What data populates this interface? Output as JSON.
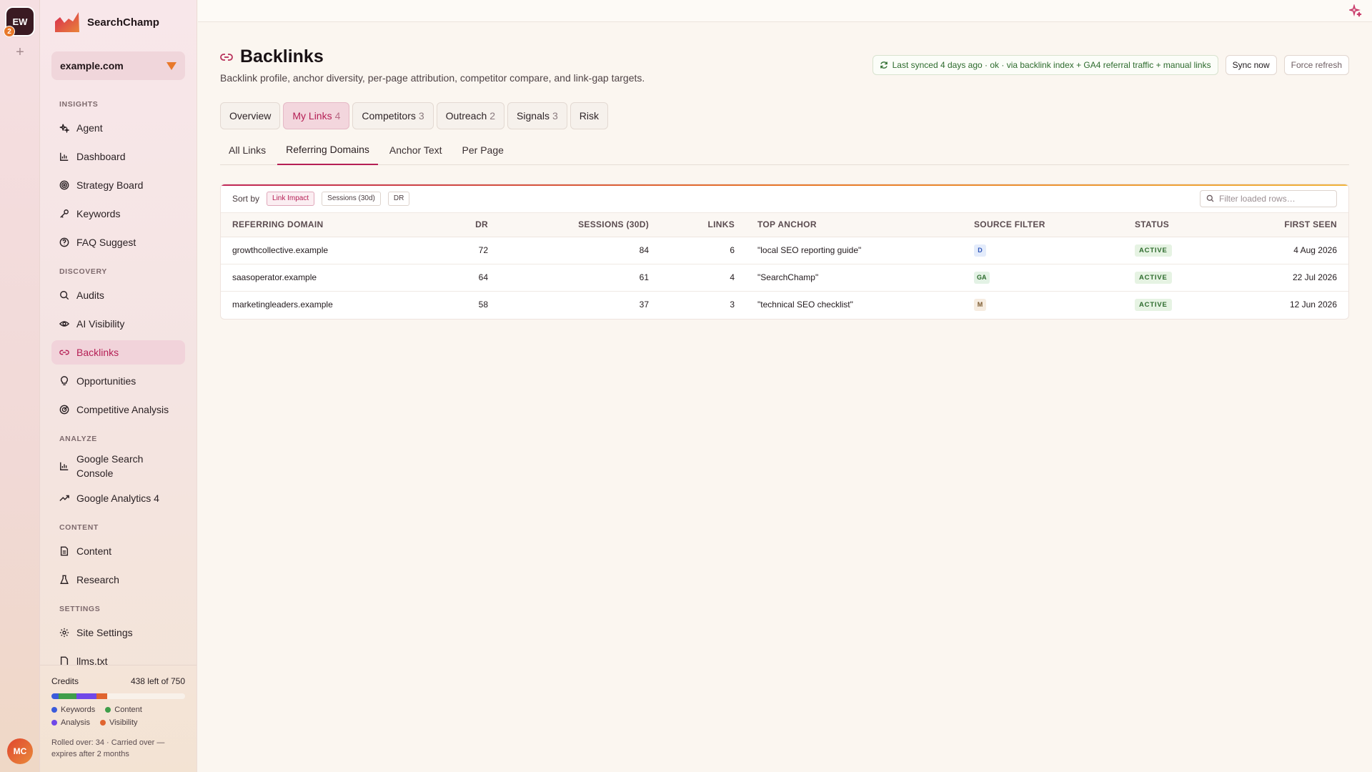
{
  "rail": {
    "workspace_initials": "EW",
    "workspace_badge": "2",
    "add_symbol": "+",
    "user_initials": "MC"
  },
  "brand": {
    "name": "SearchChamp"
  },
  "site": {
    "selected": "example.com"
  },
  "nav": {
    "insights_title": "INSIGHTS",
    "discovery_title": "DISCOVERY",
    "analyze_title": "ANALYZE",
    "content_title": "CONTENT",
    "settings_title": "SETTINGS",
    "agent": "Agent",
    "dashboard": "Dashboard",
    "strategy_board": "Strategy Board",
    "keywords": "Keywords",
    "faq_suggest": "FAQ Suggest",
    "audits": "Audits",
    "ai_visibility": "AI Visibility",
    "backlinks": "Backlinks",
    "opportunities": "Opportunities",
    "competitive_analysis": "Competitive Analysis",
    "gsc_line1": "Google Search",
    "gsc_line2": "Console",
    "ga4": "Google Analytics 4",
    "content": "Content",
    "research": "Research",
    "site_settings": "Site Settings",
    "llms": "llms.txt"
  },
  "credits": {
    "label": "Credits",
    "remaining": "438 left of 750",
    "used_fraction": 0.416,
    "segments": [
      {
        "name": "Keywords",
        "color": "#3b5bdb",
        "fraction": 0.055
      },
      {
        "name": "Content",
        "color": "#3f9e4a",
        "fraction": 0.13
      },
      {
        "name": "Analysis",
        "color": "#7048e8",
        "fraction": 0.15
      },
      {
        "name": "Visibility",
        "color": "#e0642f",
        "fraction": 0.081
      }
    ],
    "legend_keywords": "Keywords",
    "legend_content": "Content",
    "legend_analysis": "Analysis",
    "legend_visibility": "Visibility",
    "note": "Rolled over: 34 · Carried over — expires after 2 months"
  },
  "page": {
    "title": "Backlinks",
    "subtitle": "Backlink profile, anchor diversity, per-page attribution, competitor compare, and link-gap targets.",
    "sync_status": "Last synced 4 days ago · ok · via backlink index + GA4 referral traffic + manual links",
    "sync_now": "Sync now",
    "force_refresh": "Force refresh"
  },
  "tabs": [
    {
      "label": "Overview",
      "count": ""
    },
    {
      "label": "My Links",
      "count": "4"
    },
    {
      "label": "Competitors",
      "count": "3"
    },
    {
      "label": "Outreach",
      "count": "2"
    },
    {
      "label": "Signals",
      "count": "3"
    },
    {
      "label": "Risk",
      "count": ""
    }
  ],
  "subtabs": [
    "All Links",
    "Referring Domains",
    "Anchor Text",
    "Per Page"
  ],
  "table": {
    "sort_label": "Sort by",
    "sort_options": [
      "Link Impact",
      "Sessions (30d)",
      "DR"
    ],
    "filter_placeholder": "Filter loaded rows…",
    "headers": {
      "domain": "REFERRING DOMAIN",
      "dr": "DR",
      "sessions": "SESSIONS (30D)",
      "links": "LINKS",
      "anchor": "TOP ANCHOR",
      "source": "SOURCE FILTER",
      "status": "STATUS",
      "first_seen": "FIRST SEEN"
    },
    "rows": [
      {
        "domain": "growthcollective.example",
        "dr": "72",
        "sessions": "84",
        "links": "6",
        "anchor": "\"local SEO reporting guide\"",
        "source": "D",
        "status": "ACTIVE",
        "first_seen": "4 Aug 2026"
      },
      {
        "domain": "saasoperator.example",
        "dr": "64",
        "sessions": "61",
        "links": "4",
        "anchor": "\"SearchChamp\"",
        "source": "GA",
        "status": "ACTIVE",
        "first_seen": "22 Jul 2026"
      },
      {
        "domain": "marketingleaders.example",
        "dr": "58",
        "sessions": "37",
        "links": "3",
        "anchor": "\"technical SEO checklist\"",
        "source": "M",
        "status": "ACTIVE",
        "first_seen": "12 Jun 2026"
      }
    ]
  },
  "colors": {
    "accent": "#b51f55",
    "brand_orange": "#e8782a",
    "active_green": "#2d6b2d"
  }
}
